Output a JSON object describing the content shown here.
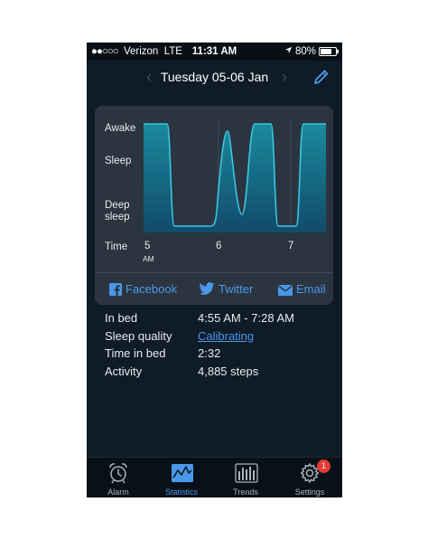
{
  "status_bar": {
    "signal_dots": "●●○○○",
    "carrier": "Verizon",
    "network": "LTE",
    "time": "11:31 AM",
    "location_icon": "location-arrow-icon",
    "battery": "80%"
  },
  "nav": {
    "prev": "‹",
    "title": "Tuesday 05-06 Jan",
    "next": "›",
    "edit_icon": "pencil-icon"
  },
  "chart": {
    "y_labels": {
      "awake": "Awake",
      "sleep": "Sleep",
      "deep_line1": "Deep",
      "deep_line2": "sleep"
    },
    "x_title": "Time",
    "x_ticks": [
      {
        "label": "5",
        "sub": "AM"
      },
      {
        "label": "6",
        "sub": ""
      },
      {
        "label": "7",
        "sub": ""
      }
    ],
    "colors": {
      "line": "#39c6e0",
      "fill_top": "#1a8a9c",
      "fill_bottom": "#124a6d"
    }
  },
  "share": {
    "facebook": "Facebook",
    "twitter": "Twitter",
    "email": "Email"
  },
  "details": [
    {
      "key": "In bed",
      "value": "4:55 AM - 7:28 AM",
      "link": false
    },
    {
      "key": "Sleep quality",
      "value": "Calibrating",
      "link": true
    },
    {
      "key": "Time in bed",
      "value": "2:32",
      "link": false
    },
    {
      "key": "Activity",
      "value": "4,885 steps",
      "link": false
    }
  ],
  "tabs": [
    {
      "label": "Alarm",
      "icon": "alarm-clock-icon",
      "active": false
    },
    {
      "label": "Statistics",
      "icon": "statistics-icon",
      "active": true
    },
    {
      "label": "Trends",
      "icon": "trends-icon",
      "active": false
    },
    {
      "label": "Settings",
      "icon": "settings-gear-icon",
      "active": false,
      "badge": "1"
    }
  ],
  "accent_color": "#4a98e9"
}
